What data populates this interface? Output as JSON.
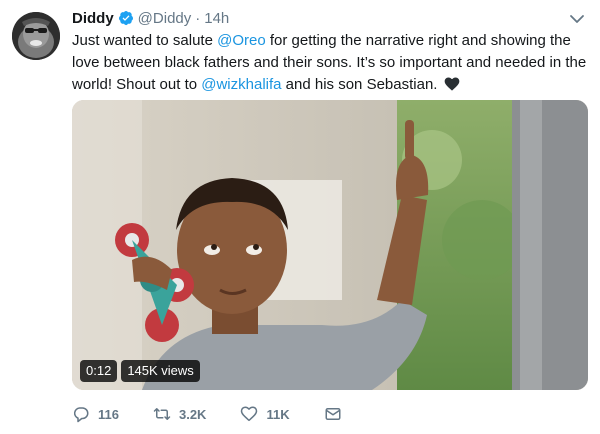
{
  "tweet": {
    "author": {
      "name": "Diddy",
      "handle": "@Diddy",
      "separator": "·",
      "time": "14h"
    },
    "text": {
      "p1": "Just wanted to salute ",
      "m1": "@Oreo",
      "p2": " for getting the narrative right and showing the love between black fathers and their sons. It’s so important and needed in the world! Shout out to ",
      "m2": "@wizkhalifa",
      "p3": " and his son Sebastian. "
    },
    "video": {
      "duration": "0:12",
      "views": "145K views"
    },
    "actions": {
      "replies": "116",
      "retweets": "3.2K",
      "likes": "11K"
    },
    "colors": {
      "link": "#1b95e0",
      "secondary_text": "#657786",
      "verified": "#1da1f2"
    },
    "icons": [
      "verified-badge-icon",
      "chevron-down-icon",
      "black-heart-icon",
      "reply-icon",
      "retweet-icon",
      "like-icon",
      "direct-message-icon"
    ]
  }
}
